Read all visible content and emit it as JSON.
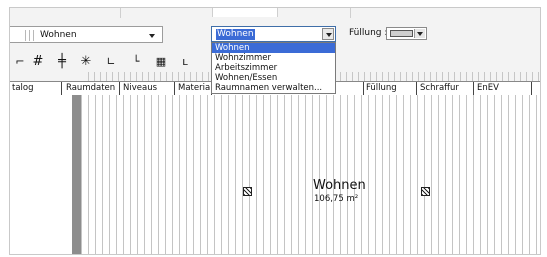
{
  "toolbar_top": {
    "layer_combo_value": "Wohnen",
    "room_name_combo": {
      "value": "Wohnen",
      "options": [
        "Wohnen",
        "Wohnzimmer",
        "Arbeitszimmer",
        "Wohnen/Essen",
        "Raumnamen verwalten..."
      ],
      "selected_index": 0
    },
    "fill_label": "Füllung :",
    "fill_color": "#cfcfcf"
  },
  "tool_icons": [
    "partial-frame-icon",
    "grid-icon",
    "crosshair-grid-icon",
    "asterisk-icon",
    "measure-angle-icon",
    "corner-axis-icon",
    "dotted-grid-icon",
    "partial-icon"
  ],
  "tabs": [
    "talog",
    "Raumdaten",
    "Niveaus",
    "Materia",
    "Füllung",
    "Schraffur",
    "EnEV"
  ],
  "room": {
    "name": "Wohnen",
    "area": "106,75 m²"
  },
  "colors": {
    "selection": "#3b6bd6",
    "gutter": "#8d8d8d"
  }
}
